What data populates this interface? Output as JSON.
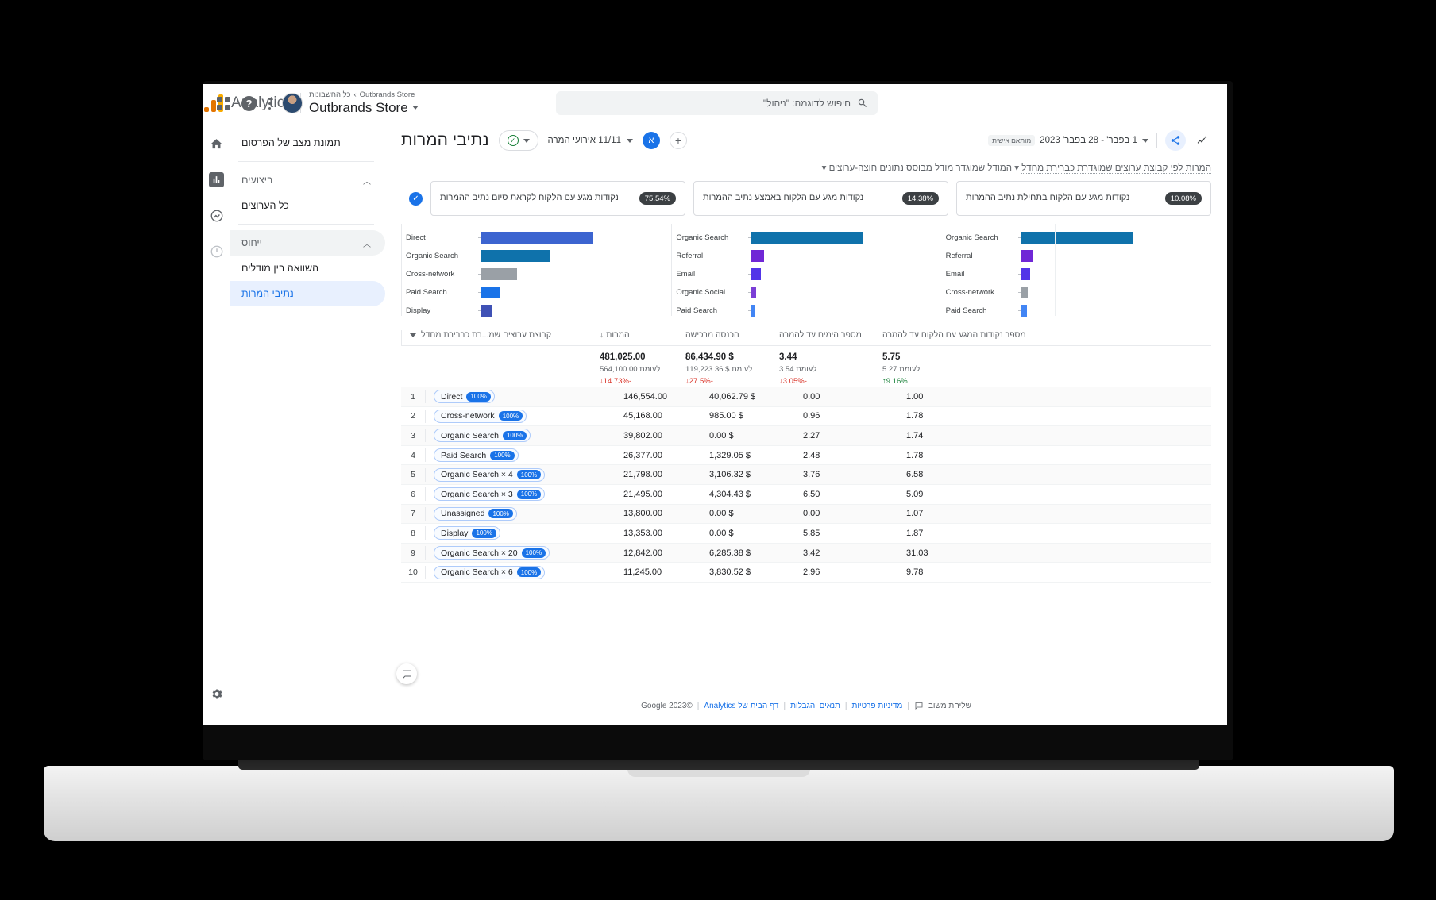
{
  "topbar": {
    "brand_name": "Analytics",
    "account_breadcrumb": "כל החשבונות",
    "account_property": "Outbrands Store",
    "account_name": "Outbrands Store",
    "search_placeholder": "חיפוש לדוגמה: \"ניהול\"",
    "icons": {
      "search": "search-icon",
      "apps": "apps-grid-icon",
      "help": "help-icon",
      "more": "more-vert-icon",
      "avatar": "user-avatar"
    }
  },
  "rail": {
    "items": [
      {
        "name": "home-icon",
        "label": "דף הבית"
      },
      {
        "name": "reports-icon",
        "label": "דוחות"
      },
      {
        "name": "explore-icon",
        "label": "ניתוח נתונים"
      },
      {
        "name": "advertising-icon",
        "label": "פרסום"
      }
    ],
    "gear": "admin-gear-icon"
  },
  "nav": {
    "items": [
      {
        "label": "תמונת מצב של הפרסום",
        "type": "item",
        "state": "normal"
      },
      {
        "label": "ביצועים",
        "type": "group",
        "state": "collapsible"
      },
      {
        "label": "כל הערוצים",
        "type": "item",
        "state": "normal"
      },
      {
        "label": "ייחוס",
        "type": "group",
        "state": "collapsible"
      },
      {
        "label": "השוואה בין מודלים",
        "type": "item",
        "state": "normal"
      },
      {
        "label": "נתיבי המרות",
        "type": "item",
        "state": "active"
      }
    ],
    "chevron": "chevron-up-icon",
    "collapse": "chevron-left-icon"
  },
  "page": {
    "title": "נתיבי המרות",
    "conversion_chip": "11/11 אירועי המרה",
    "audience_badge": "א",
    "add_label": "+",
    "date_range": "1 בפבר' - 28 בפבר' 2023",
    "date_badge": "מותאם אישית",
    "subtitle_prefix": "המרות לפי קבוצת ערוצים שמוגדרת כברירת מחדל",
    "subtitle_model": "המודל שמוגדר מודל מבוסס נתונים חוצה-ערוצים"
  },
  "funnel": {
    "stages": [
      {
        "pct": "75.54%",
        "label": "נקודות מגע עם הלקוח לקראת סיום נתיב ההמרות"
      },
      {
        "pct": "14.38%",
        "label": "נקודות מגע עם הלקוח באמצע נתיב ההמרות"
      },
      {
        "pct": "10.08%",
        "label": "נקודות מגע עם הלקוח בתחילת נתיב ההמרות"
      }
    ]
  },
  "chart_data": [
    {
      "type": "bar",
      "title": "נקודות מגע עם הלקוח לקראת סיום נתיב ההמרות",
      "orientation": "horizontal",
      "categories": [
        "Direct",
        "Organic Search",
        "Cross-network",
        "Paid Search",
        "Display"
      ],
      "values": [
        100,
        62,
        32,
        17,
        9
      ],
      "colors": [
        "#3c64d0",
        "#0f72ab",
        "#9aa0a6",
        "#1a73e8",
        "#3f51b5"
      ],
      "xlabel": "",
      "ylabel": "",
      "grid": true
    },
    {
      "type": "bar",
      "title": "נקודות מגע עם הלקוח באמצע נתיב ההמרות",
      "orientation": "horizontal",
      "categories": [
        "Organic Search",
        "Referral",
        "Email",
        "Organic Social",
        "Paid Search"
      ],
      "values": [
        100,
        11,
        8,
        4,
        3
      ],
      "colors": [
        "#0f72ab",
        "#7027d6",
        "#5235e8",
        "#7b3fd6",
        "#4285f4"
      ],
      "xlabel": "",
      "ylabel": "",
      "grid": true
    },
    {
      "type": "bar",
      "title": "נקודות מגע עם הלקוח בתחילת נתיב ההמרות",
      "orientation": "horizontal",
      "categories": [
        "Organic Search",
        "Referral",
        "Email",
        "Cross-network",
        "Paid Search"
      ],
      "values": [
        100,
        11,
        8,
        6,
        5
      ],
      "colors": [
        "#0f72ab",
        "#7027d6",
        "#5235e8",
        "#9aa0a6",
        "#4285f4"
      ],
      "xlabel": "",
      "ylabel": "",
      "grid": true
    }
  ],
  "table": {
    "headers": [
      "קבוצת ערוצים שמ...רת כברירת מחדל",
      "המרות",
      "הכנסה מרכישה",
      "מספר הימים עד להמרה",
      "מספר נקודות המגע עם הלקוח עד להמרה"
    ],
    "sort_indicator": "↓",
    "summary": {
      "conversions": {
        "value": "481,025.00",
        "prev_label": "לעומת 564,100.00",
        "delta": "-14.73%↓",
        "dir": "down"
      },
      "revenue": {
        "value": "$ 86,434.90",
        "prev_label": "לעומת $ 119,223.36",
        "delta": "-27.5%↓",
        "dir": "down"
      },
      "days": {
        "value": "3.44",
        "prev_label": "לעומת 3.54",
        "delta": "-3.05%↓",
        "dir": "down"
      },
      "touchpoints": {
        "value": "5.75",
        "prev_label": "לעומת 5.27",
        "delta": "9.16%↑",
        "dir": "up"
      }
    },
    "rows": [
      {
        "n": "1",
        "pct": "100%",
        "path": "Direct",
        "conversions": "146,554.00",
        "revenue": "$ 40,062.79",
        "days": "0.00",
        "touchpoints": "1.00"
      },
      {
        "n": "2",
        "pct": "100%",
        "path": "Cross-network",
        "conversions": "45,168.00",
        "revenue": "$ 985.00",
        "days": "0.96",
        "touchpoints": "1.78"
      },
      {
        "n": "3",
        "pct": "100%",
        "path": "Organic Search",
        "conversions": "39,802.00",
        "revenue": "$ 0.00",
        "days": "2.27",
        "touchpoints": "1.74"
      },
      {
        "n": "4",
        "pct": "100%",
        "path": "Paid Search",
        "conversions": "26,377.00",
        "revenue": "$ 1,329.05",
        "days": "2.48",
        "touchpoints": "1.78"
      },
      {
        "n": "5",
        "pct": "100%",
        "path": "4 × Organic Search",
        "conversions": "21,798.00",
        "revenue": "$ 3,106.32",
        "days": "3.76",
        "touchpoints": "6.58"
      },
      {
        "n": "6",
        "pct": "100%",
        "path": "3 × Organic Search",
        "conversions": "21,495.00",
        "revenue": "$ 4,304.43",
        "days": "6.50",
        "touchpoints": "5.09"
      },
      {
        "n": "7",
        "pct": "100%",
        "path": "Unassigned",
        "conversions": "13,800.00",
        "revenue": "$ 0.00",
        "days": "0.00",
        "touchpoints": "1.07"
      },
      {
        "n": "8",
        "pct": "100%",
        "path": "Display",
        "conversions": "13,353.00",
        "revenue": "$ 0.00",
        "days": "5.85",
        "touchpoints": "1.87"
      },
      {
        "n": "9",
        "pct": "100%",
        "path": "20 × Organic Search",
        "conversions": "12,842.00",
        "revenue": "$ 6,285.38",
        "days": "3.42",
        "touchpoints": "31.03"
      },
      {
        "n": "10",
        "pct": "100%",
        "path": "6 × Organic Search",
        "conversions": "11,245.00",
        "revenue": "$ 3,830.52",
        "days": "2.96",
        "touchpoints": "9.78"
      }
    ]
  },
  "footer": {
    "copyright": "©2023 Google",
    "link_home": "דף הבית של Analytics",
    "link_terms": "תנאים והגבלות",
    "link_privacy": "מדיניות פרטיות",
    "feedback": "שליחת משוב",
    "sep": "|"
  },
  "colors": {
    "accent": "#1a73e8",
    "accent_bg": "#e8f0fe",
    "text": "#202124",
    "muted": "#5f6368",
    "border": "#dadce0",
    "up": "#188038",
    "down": "#d93025"
  }
}
